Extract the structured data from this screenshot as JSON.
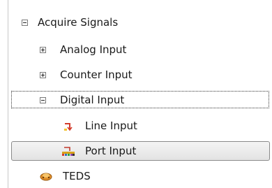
{
  "tree": {
    "root": {
      "label": "Acquire Signals",
      "expanded": true
    },
    "items": [
      {
        "label": "Analog Input",
        "expanded": false,
        "has_children": true
      },
      {
        "label": "Counter Input",
        "expanded": false,
        "has_children": true
      },
      {
        "label": "Digital Input",
        "expanded": true,
        "has_children": true,
        "focused": true
      },
      {
        "label": "Line Input",
        "icon": "line-input-icon"
      },
      {
        "label": "Port Input",
        "icon": "port-input-icon",
        "selected": true
      }
    ],
    "sibling": {
      "label": "TEDS",
      "icon": "teds-icon"
    }
  }
}
